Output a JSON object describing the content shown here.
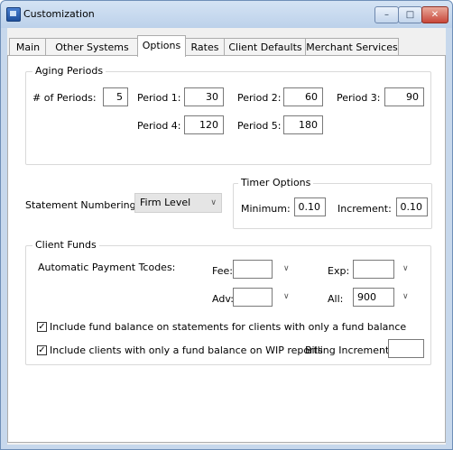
{
  "window": {
    "title": "Customization",
    "minimize_glyph": "–",
    "maximize_glyph": "□",
    "close_glyph": "✕"
  },
  "tabs": [
    "Main",
    "Other Systems",
    "Options",
    "Rates",
    "Client Defaults",
    "Merchant Services"
  ],
  "active_tab": "Options",
  "aging": {
    "legend": "Aging Periods",
    "num_periods_label": "# of Periods:",
    "num_periods_value": "5",
    "p1_label": "Period 1:",
    "p1_value": "30",
    "p2_label": "Period 2:",
    "p2_value": "60",
    "p3_label": "Period 3:",
    "p3_value": "90",
    "p4_label": "Period 4:",
    "p4_value": "120",
    "p5_label": "Period 5:",
    "p5_value": "180"
  },
  "statement": {
    "label": "Statement Numbering:",
    "value": "Firm Level"
  },
  "timer": {
    "legend": "Timer Options",
    "min_label": "Minimum:",
    "min_value": "0.10",
    "inc_label": "Increment:",
    "inc_value": "0.10"
  },
  "funds": {
    "legend": "Client Funds",
    "tcodes_label": "Automatic Payment Tcodes:",
    "fee_label": "Fee:",
    "fee_value": "",
    "exp_label": "Exp:",
    "exp_value": "",
    "adv_label": "Adv:",
    "adv_value": "",
    "all_label": "All:",
    "all_value": "900",
    "check1_label": "Include fund balance on statements for clients with only a fund balance",
    "check1_checked": true,
    "check2_label": "Include clients with only a fund balance on WIP reports",
    "check2_checked": true,
    "billing_label": "Billing Increment:",
    "billing_value": ""
  },
  "icons": {
    "dropdown": "∨",
    "check": "✓"
  }
}
